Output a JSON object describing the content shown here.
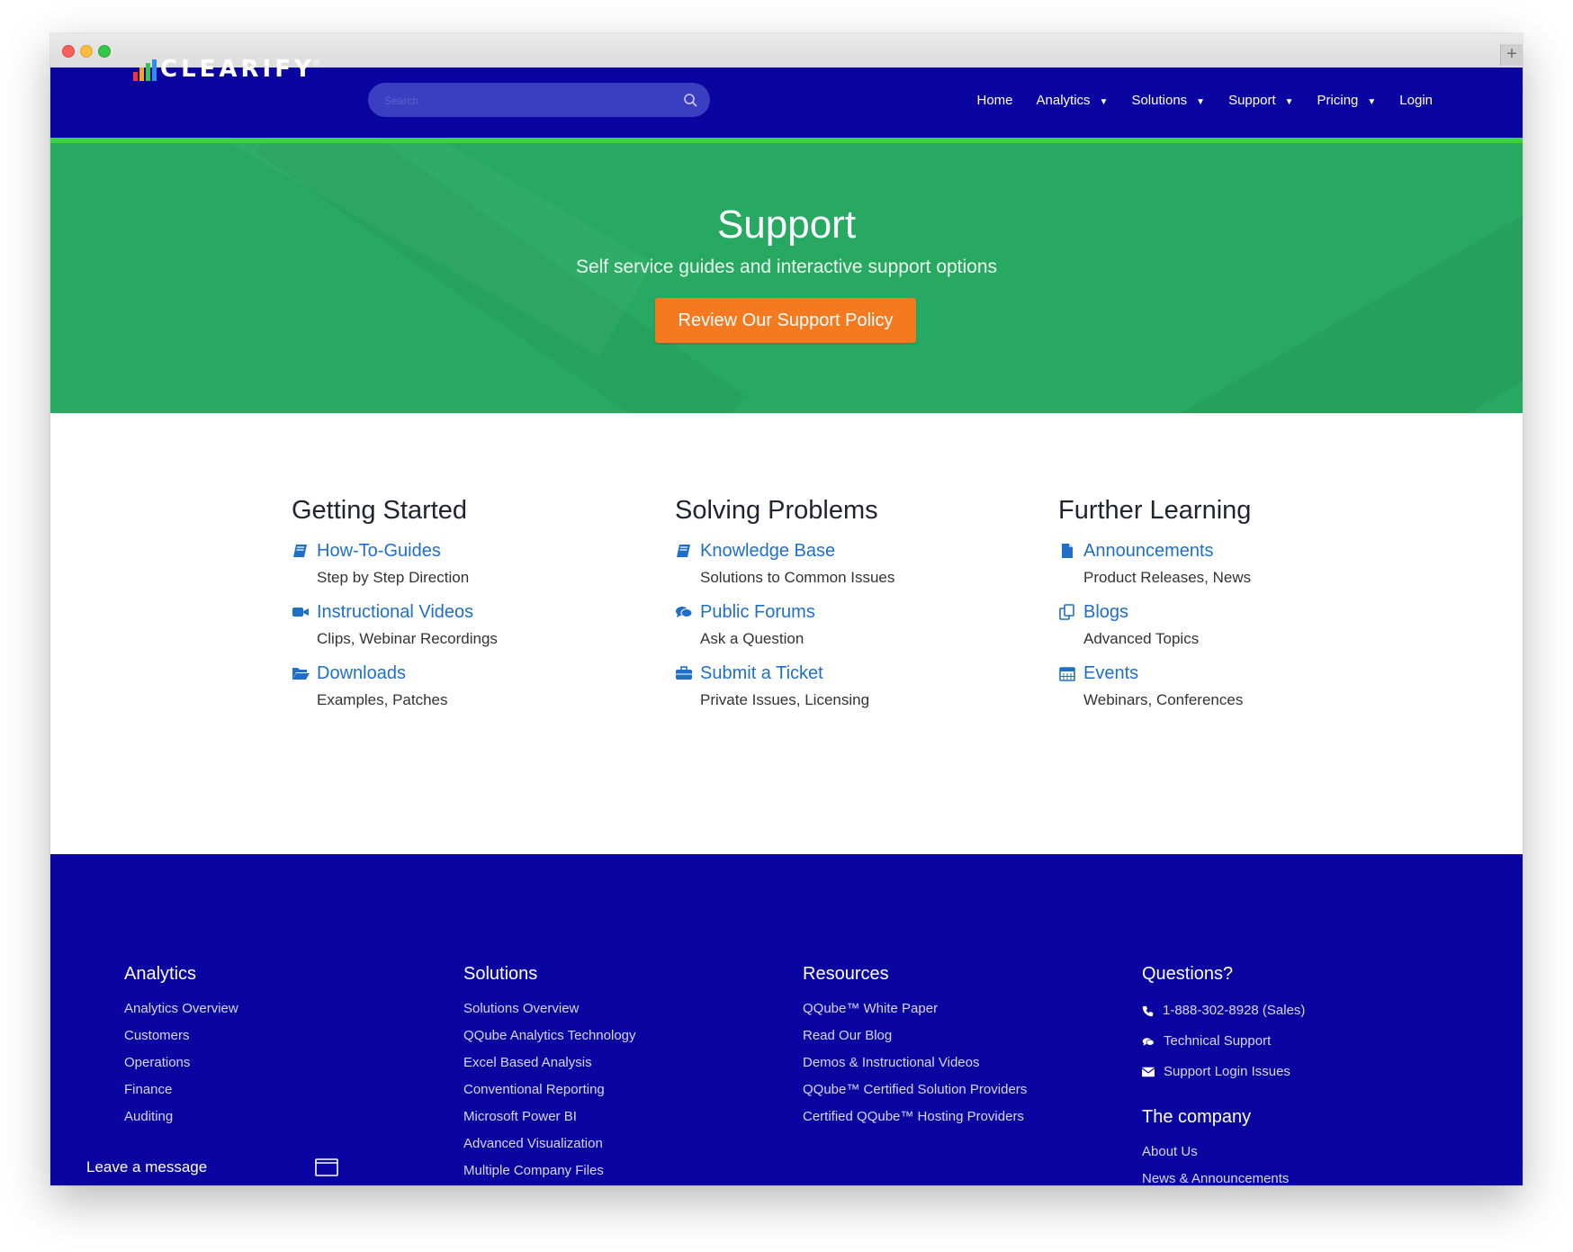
{
  "brand": {
    "name": "CLEARIFY",
    "registered_mark": "®",
    "logo_bar_colors": [
      "#f4323a",
      "#f8a31d",
      "#34c84a",
      "#2e8ef0"
    ]
  },
  "colors": {
    "nav_bg": "#0a04a0",
    "accent_stripe": "#3ecf4a",
    "hero_bg": "#27a962",
    "cta": "#f57a1f",
    "link": "#1f6fc8"
  },
  "search": {
    "placeholder": "Search",
    "icon": "search-icon"
  },
  "nav": {
    "items": [
      {
        "label": "Home",
        "dropdown": false
      },
      {
        "label": "Analytics",
        "dropdown": true
      },
      {
        "label": "Solutions",
        "dropdown": true
      },
      {
        "label": "Support",
        "dropdown": true
      },
      {
        "label": "Pricing",
        "dropdown": true
      },
      {
        "label": "Login",
        "dropdown": false
      }
    ],
    "caret": "▼"
  },
  "hero": {
    "title": "Support",
    "subtitle": "Self service guides and interactive support options",
    "button_label": "Review Our Support Policy"
  },
  "sections": [
    {
      "heading": "Getting Started",
      "items": [
        {
          "icon": "book-icon",
          "title": "How-To-Guides",
          "desc": "Step by Step Direction"
        },
        {
          "icon": "video-camera-icon",
          "title": "Instructional Videos",
          "desc": "Clips, Webinar Recordings"
        },
        {
          "icon": "folder-open-icon",
          "title": "Downloads",
          "desc": "Examples, Patches"
        }
      ]
    },
    {
      "heading": "Solving Problems",
      "items": [
        {
          "icon": "book-icon",
          "title": "Knowledge Base",
          "desc": "Solutions to Common Issues"
        },
        {
          "icon": "comments-icon",
          "title": "Public Forums",
          "desc": "Ask a Question"
        },
        {
          "icon": "briefcase-icon",
          "title": "Submit a Ticket",
          "desc": "Private Issues, Licensing"
        }
      ]
    },
    {
      "heading": "Further Learning",
      "items": [
        {
          "icon": "document-icon",
          "title": "Announcements",
          "desc": "Product Releases, News"
        },
        {
          "icon": "copy-icon",
          "title": "Blogs",
          "desc": "Advanced Topics"
        },
        {
          "icon": "calendar-icon",
          "title": "Events",
          "desc": "Webinars, Conferences"
        }
      ]
    }
  ],
  "footer": {
    "analytics": {
      "heading": "Analytics",
      "links": [
        "Analytics Overview",
        "Customers",
        "Operations",
        "Finance",
        "Auditing"
      ]
    },
    "solutions": {
      "heading": "Solutions",
      "links": [
        "Solutions Overview",
        "QQube Analytics Technology",
        "Excel Based Analysis",
        "Conventional Reporting",
        "Microsoft Power BI",
        "Advanced Visualization",
        "Multiple Company Files"
      ]
    },
    "resources": {
      "heading": "Resources",
      "links": [
        "QQube™ White Paper",
        "Read Our Blog",
        "Demos & Instructional Videos",
        "QQube™ Certified Solution Providers",
        "Certified QQube™ Hosting Providers"
      ]
    },
    "questions": {
      "heading": "Questions?",
      "contacts": [
        {
          "icon": "phone-icon",
          "label": "1-888-302-8928 (Sales)"
        },
        {
          "icon": "comments-icon",
          "label": "Technical Support"
        },
        {
          "icon": "envelope-icon",
          "label": "Support Login Issues"
        }
      ]
    },
    "company": {
      "heading": "The company",
      "links": [
        "About Us",
        "News & Announcements"
      ]
    }
  },
  "chat": {
    "label": "Leave a message",
    "icon": "chat-window-icon"
  }
}
